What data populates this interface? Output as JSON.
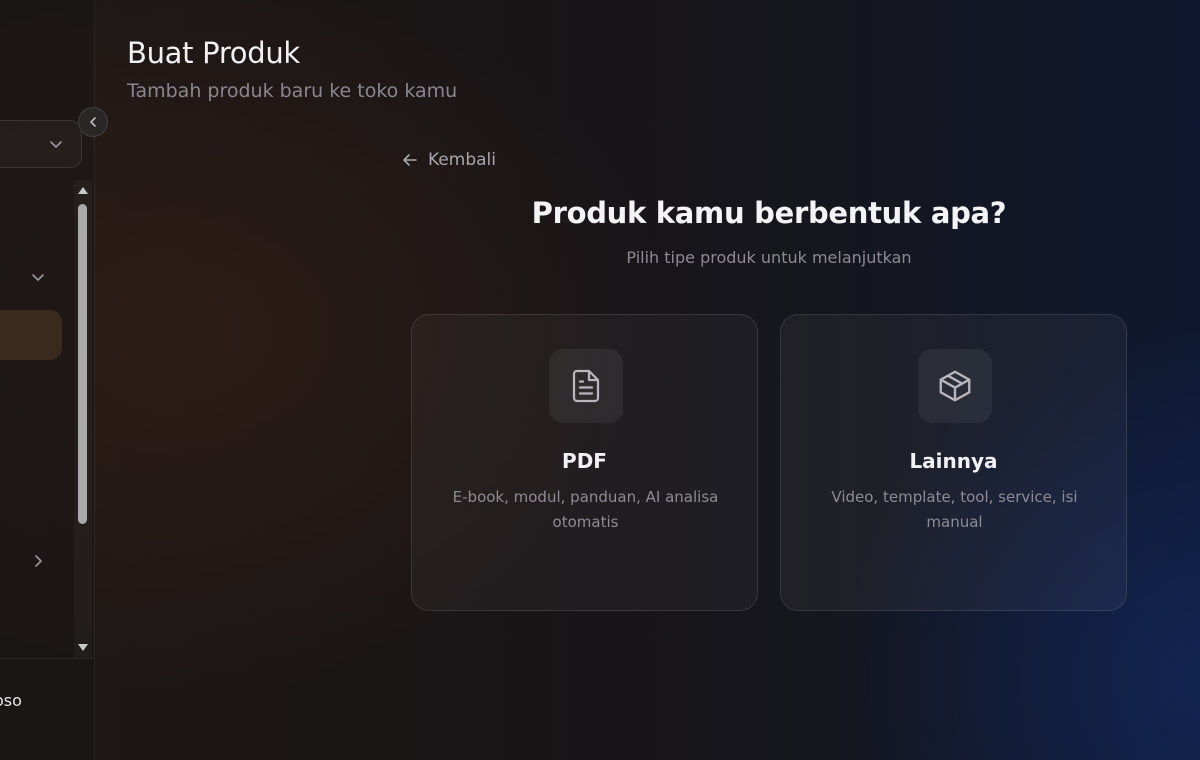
{
  "header": {
    "title": "Buat Produk",
    "subtitle": "Tambah produk baru ke toko kamu"
  },
  "sidebar": {
    "user_name_fragment": "oso"
  },
  "back_link": {
    "label": "Kembali"
  },
  "question": {
    "title": "Produk kamu berbentuk apa?",
    "subtitle": "Pilih tipe produk untuk melanjutkan"
  },
  "cards": [
    {
      "icon": "file-text-icon",
      "title": "PDF",
      "description": "E-book, modul, panduan, AI analisa otomatis"
    },
    {
      "icon": "package-icon",
      "title": "Lainnya",
      "description": "Video, template, tool, service, isi manual"
    }
  ],
  "colors": {
    "active_nav": "#3a2a1e",
    "accent_bg_dark": "#1e1715",
    "accent_bg_blue": "#0f1830"
  }
}
